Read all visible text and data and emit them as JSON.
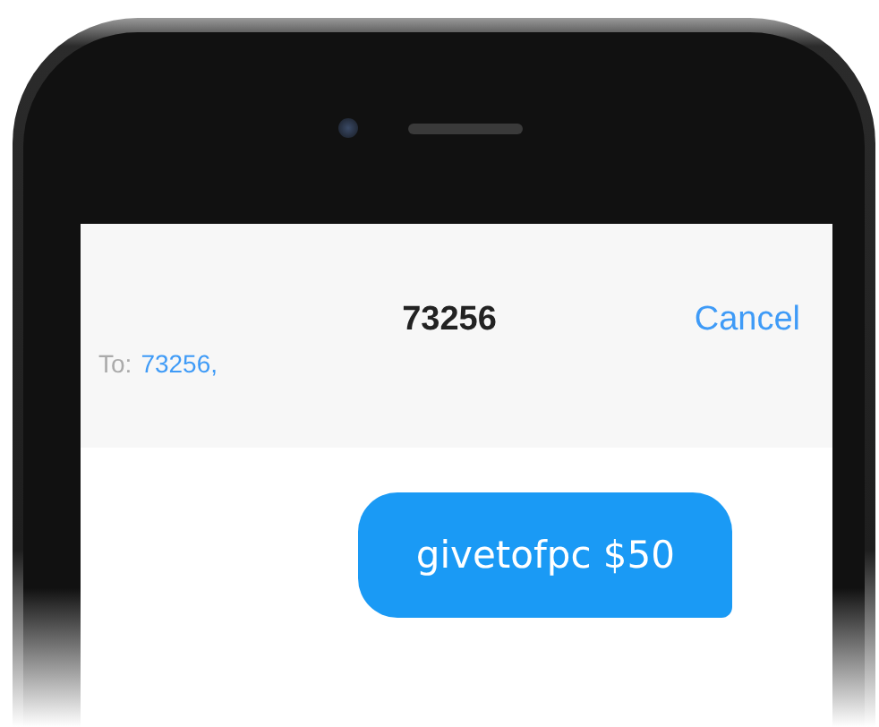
{
  "header": {
    "title": "73256",
    "cancel": "Cancel"
  },
  "recipient": {
    "label": "To:",
    "value": "73256,"
  },
  "messages": [
    {
      "text": "givetofpc $50",
      "kind": "sent"
    }
  ]
}
